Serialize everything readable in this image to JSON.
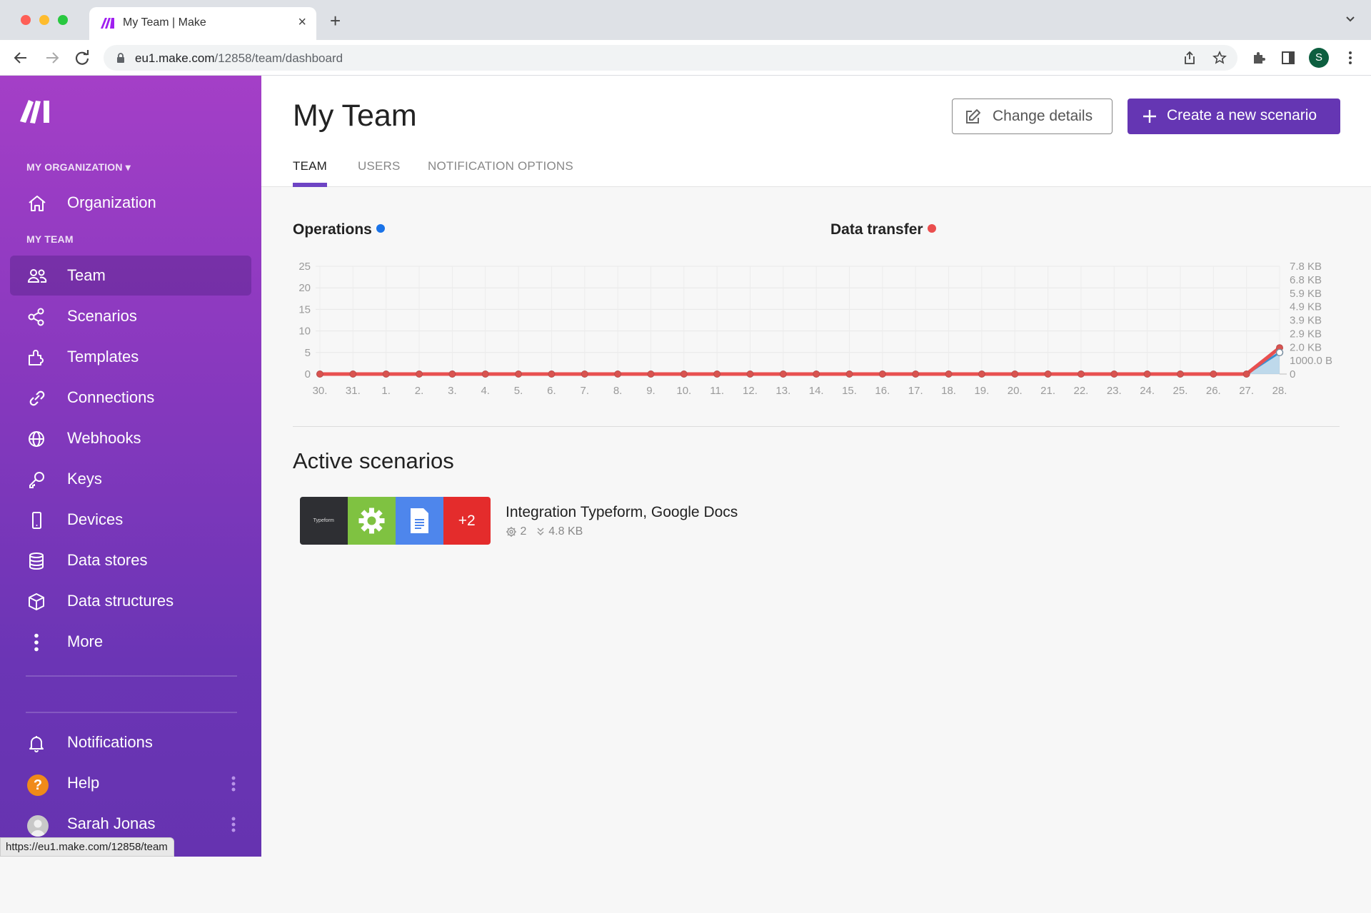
{
  "browser": {
    "tab_title": "My Team | Make",
    "url_host": "eu1.make.com",
    "url_path": "/12858/team/dashboard",
    "profile_initial": "S",
    "status_bar_url": "https://eu1.make.com/12858/team"
  },
  "sidebar": {
    "org_section_label": "MY ORGANIZATION ▾",
    "team_section_label": "MY TEAM",
    "organization_item": "Organization",
    "items": [
      {
        "label": "Team",
        "icon": "users-icon",
        "active": true
      },
      {
        "label": "Scenarios",
        "icon": "share-nodes-icon"
      },
      {
        "label": "Templates",
        "icon": "puzzle-icon"
      },
      {
        "label": "Connections",
        "icon": "link-icon"
      },
      {
        "label": "Webhooks",
        "icon": "globe-icon"
      },
      {
        "label": "Keys",
        "icon": "key-icon"
      },
      {
        "label": "Devices",
        "icon": "mobile-icon"
      },
      {
        "label": "Data stores",
        "icon": "database-icon"
      },
      {
        "label": "Data structures",
        "icon": "cube-icon"
      },
      {
        "label": "More",
        "icon": "more-vertical-icon"
      }
    ],
    "bottom": {
      "notifications": "Notifications",
      "help": "Help",
      "user_name": "Sarah Jonas"
    }
  },
  "header": {
    "title": "My Team",
    "change_details_label": "Change details",
    "create_scenario_label": "Create a new scenario",
    "tabs": [
      {
        "label": "TEAM",
        "active": true
      },
      {
        "label": "USERS"
      },
      {
        "label": "NOTIFICATION OPTIONS"
      }
    ]
  },
  "colors": {
    "accent": "#6536b3",
    "operations": "#1a73e8",
    "data_transfer": "#ea4e4e"
  },
  "chart_data": {
    "type": "line",
    "titles": {
      "left": "Operations",
      "right": "Data transfer"
    },
    "categories": [
      "30.",
      "31.",
      "1.",
      "2.",
      "3.",
      "4.",
      "5.",
      "6.",
      "7.",
      "8.",
      "9.",
      "10.",
      "11.",
      "12.",
      "13.",
      "14.",
      "15.",
      "16.",
      "17.",
      "18.",
      "19.",
      "20.",
      "21.",
      "22.",
      "23.",
      "24.",
      "25.",
      "26.",
      "27.",
      "28."
    ],
    "series": [
      {
        "name": "Operations",
        "axis": "left",
        "color": "#1a73e8",
        "values": [
          0,
          0,
          0,
          0,
          0,
          0,
          0,
          0,
          0,
          0,
          0,
          0,
          0,
          0,
          0,
          0,
          0,
          0,
          0,
          0,
          0,
          0,
          0,
          0,
          0,
          0,
          0,
          0,
          0,
          5
        ]
      },
      {
        "name": "Data transfer",
        "axis": "right",
        "unit": "KB",
        "color": "#ea4e4e",
        "values": [
          0,
          0,
          0,
          0,
          0,
          0,
          0,
          0,
          0,
          0,
          0,
          0,
          0,
          0,
          0,
          0,
          0,
          0,
          0,
          0,
          0,
          0,
          0,
          0,
          0,
          0,
          0,
          0,
          0,
          1.9
        ]
      }
    ],
    "left_axis": {
      "ticks": [
        "0",
        "5",
        "10",
        "15",
        "20",
        "25"
      ],
      "ylim": [
        0,
        25
      ]
    },
    "right_axis": {
      "ticks": [
        "0",
        "1000.0 B",
        "2.0 KB",
        "2.9 KB",
        "3.9 KB",
        "4.9 KB",
        "5.9 KB",
        "6.8 KB",
        "7.8 KB"
      ],
      "ylim_kb": [
        0,
        7.8
      ]
    },
    "grid": true
  },
  "active_scenarios": {
    "title": "Active scenarios",
    "items": [
      {
        "name": "Integration Typeform, Google Docs",
        "apps": [
          "Typeform",
          "Tools",
          "Google Docs"
        ],
        "more_count": "+2",
        "operations": "2",
        "data_transfer": "4.8 KB"
      }
    ]
  }
}
